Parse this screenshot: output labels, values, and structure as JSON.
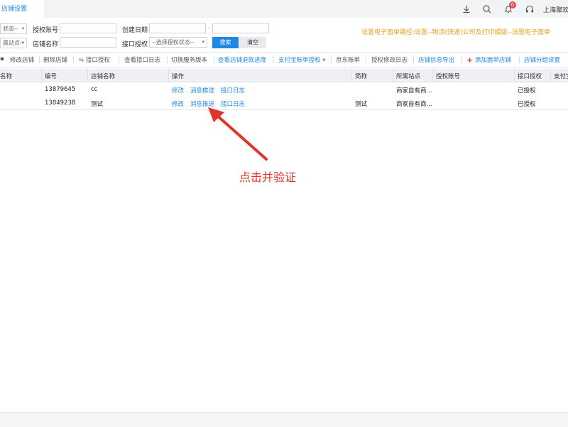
{
  "topbar": {
    "active_tab": "店铺设置",
    "notification_count": "0",
    "user_name": "上海聚欢",
    "icons": [
      "download-icon",
      "search-icon",
      "bell-icon",
      "headset-icon"
    ]
  },
  "filters": {
    "status_select": "状态--",
    "auth_account_label": "授权账号",
    "create_date_label": "创建日期",
    "date_separator": "-",
    "site_select": "属站点--",
    "shop_name_label": "店铺名称",
    "interface_auth_label": "接口授权",
    "interface_auth_select": "--选择授权状态--",
    "search_button": "搜索",
    "clear_button": "清空",
    "hint": "设置电子面单路径:设置--物流(快递)公司及打印模版--设置电子面单"
  },
  "toolbar": {
    "items": [
      {
        "label": "修改店铺",
        "style": "gray"
      },
      {
        "label": "删除店铺",
        "style": "gray"
      },
      {
        "label": "接口授权",
        "style": "gray"
      },
      {
        "label": "查看接口日志",
        "style": "gray"
      },
      {
        "label": "切换服务版本",
        "style": "gray"
      },
      {
        "label": "查看店铺退款进度",
        "style": "blue"
      },
      {
        "label": "支付宝账单授权",
        "style": "blue"
      },
      {
        "label": "京东账单",
        "style": "gray"
      },
      {
        "label": "授权修改日志",
        "style": "gray"
      },
      {
        "label": "店铺信息导出",
        "style": "blue"
      },
      {
        "label": "添加面单店铺",
        "style": "blue"
      },
      {
        "label": "店铺分组设置",
        "style": "blue"
      }
    ]
  },
  "table": {
    "headers": [
      "名称",
      "编号",
      "店铺名称",
      "操作",
      "简称",
      "所属站点",
      "授权账号",
      "接口授权",
      "支付宝"
    ],
    "actions": [
      "修改",
      "消息推送",
      "接口日志"
    ],
    "rows": [
      {
        "id": "13879645",
        "shop_name": "cc",
        "short_name": "",
        "site": "商家自有商...",
        "auth_account": "",
        "interface_auth": "已授权"
      },
      {
        "id": "13849238",
        "shop_name": "测试",
        "short_name": "测试",
        "site": "商家自有商...",
        "auth_account": "",
        "interface_auth": "已授权"
      }
    ]
  },
  "annotation": {
    "text": "点击并验证",
    "color": "#e0342a"
  },
  "colors": {
    "accent": "#1e88e5",
    "hint": "#f0a020",
    "danger": "#e53935"
  }
}
